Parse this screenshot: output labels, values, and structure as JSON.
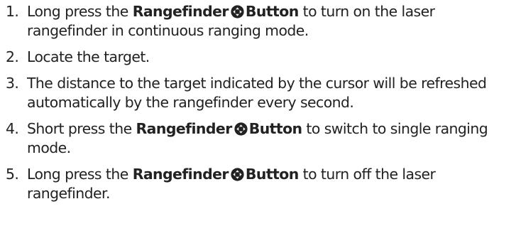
{
  "steps": [
    {
      "number": "1.",
      "pre": "Long press the ",
      "button_label": "Rangefinder",
      "button_word": "Button",
      "post": " to turn on the laser rangefinder in continuous ranging mode."
    },
    {
      "number": "2.",
      "text": "Locate the target."
    },
    {
      "number": "3.",
      "text": "The distance to the target indicated by the cursor will be refreshed automatically by the rangefinder every second."
    },
    {
      "number": "4.",
      "pre": "Short press the ",
      "button_label": "Rangefinder",
      "button_word": "Button",
      "post": " to switch to single ranging mode."
    },
    {
      "number": "5.",
      "pre": "Long press the ",
      "button_label": "Rangefinder",
      "button_word": "Button",
      "post": " to turn off the laser rangefinder."
    }
  ],
  "icon": {
    "name": "rangefinder-button-icon",
    "color": "#222222"
  }
}
